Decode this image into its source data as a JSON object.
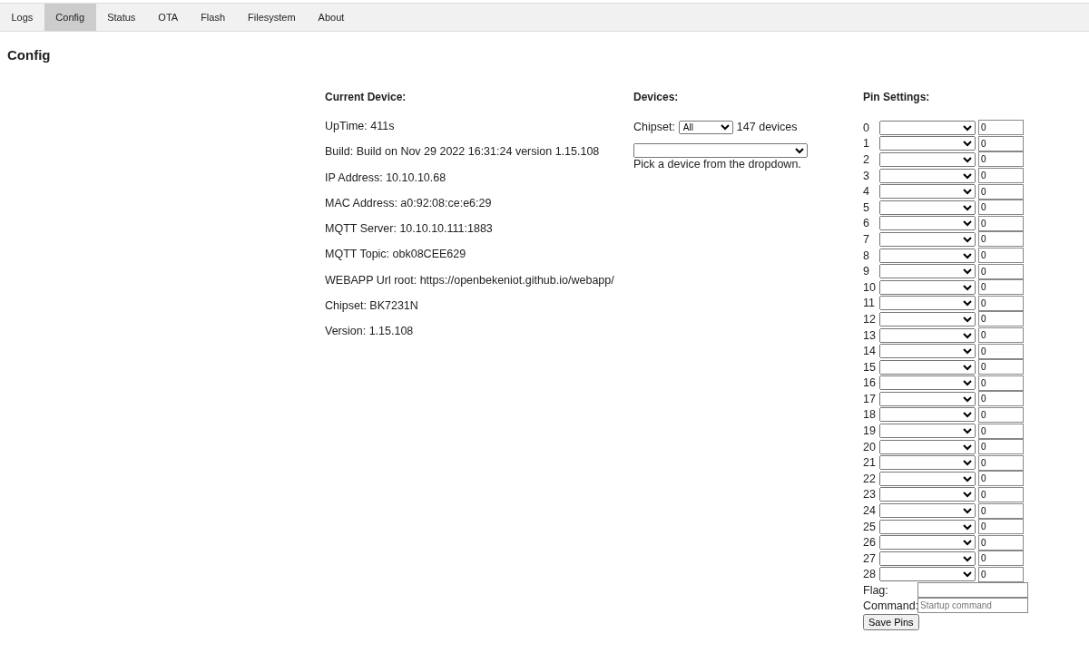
{
  "tabs": [
    {
      "label": "Logs",
      "selected": false
    },
    {
      "label": "Config",
      "selected": true
    },
    {
      "label": "Status",
      "selected": false
    },
    {
      "label": "OTA",
      "selected": false
    },
    {
      "label": "Flash",
      "selected": false
    },
    {
      "label": "Filesystem",
      "selected": false
    },
    {
      "label": "About",
      "selected": false
    }
  ],
  "page_title": "Config",
  "current_device": {
    "heading": "Current Device:",
    "lines": [
      "UpTime: 411s",
      "Build: Build on Nov 29 2022 16:31:24 version 1.15.108",
      "IP Address: 10.10.10.68",
      "MAC Address: a0:92:08:ce:e6:29",
      "MQTT Server: 10.10.10.111:1883",
      "MQTT Topic: obk08CEE629",
      "WEBAPP Url root: https://openbekeniot.github.io/webapp/",
      "Chipset: BK7231N",
      "Version: 1.15.108"
    ]
  },
  "devices": {
    "heading": "Devices:",
    "chipset_label": "Chipset:",
    "chipset_value": "All",
    "count": "147 devices",
    "hint": "Pick a device from the dropdown."
  },
  "pin_settings": {
    "heading": "Pin Settings:",
    "pins": [
      {
        "label": "0",
        "value": "0"
      },
      {
        "label": "1",
        "value": "0"
      },
      {
        "label": "2",
        "value": "0"
      },
      {
        "label": "3",
        "value": "0"
      },
      {
        "label": "4",
        "value": "0"
      },
      {
        "label": "5",
        "value": "0"
      },
      {
        "label": "6",
        "value": "0"
      },
      {
        "label": "7",
        "value": "0"
      },
      {
        "label": "8",
        "value": "0"
      },
      {
        "label": "9",
        "value": "0"
      },
      {
        "label": "10",
        "value": "0"
      },
      {
        "label": "11",
        "value": "0"
      },
      {
        "label": "12",
        "value": "0"
      },
      {
        "label": "13",
        "value": "0"
      },
      {
        "label": "14",
        "value": "0"
      },
      {
        "label": "15",
        "value": "0"
      },
      {
        "label": "16",
        "value": "0"
      },
      {
        "label": "17",
        "value": "0"
      },
      {
        "label": "18",
        "value": "0"
      },
      {
        "label": "19",
        "value": "0"
      },
      {
        "label": "20",
        "value": "0"
      },
      {
        "label": "21",
        "value": "0"
      },
      {
        "label": "22",
        "value": "0"
      },
      {
        "label": "23",
        "value": "0"
      },
      {
        "label": "24",
        "value": "0"
      },
      {
        "label": "25",
        "value": "0"
      },
      {
        "label": "26",
        "value": "0"
      },
      {
        "label": "27",
        "value": "0"
      },
      {
        "label": "28",
        "value": "0"
      }
    ],
    "flag_label": "Flag:",
    "command_label": "Command:",
    "command_placeholder": "Startup command",
    "save_button": "Save Pins"
  }
}
